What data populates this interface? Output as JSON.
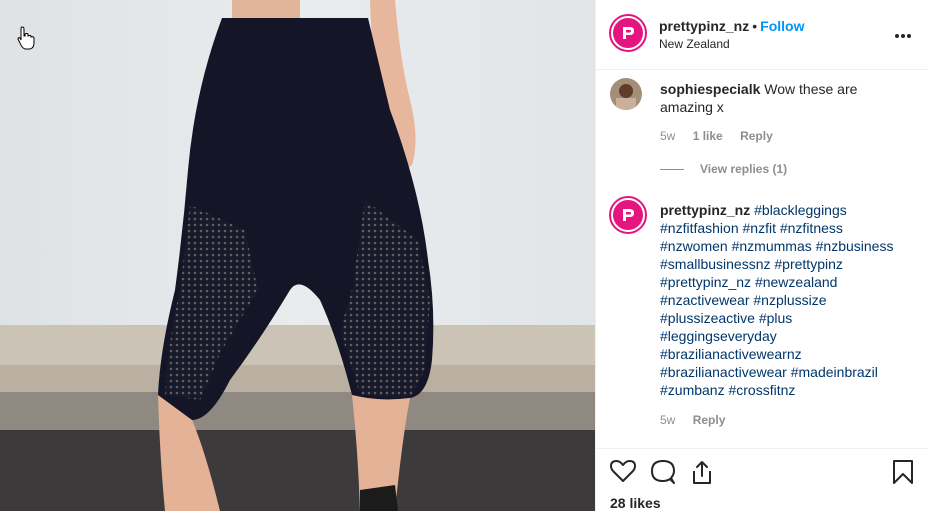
{
  "post": {
    "username": "prettypinz_nz",
    "separator": "•",
    "follow_label": "Follow",
    "location": "New Zealand",
    "more_icon": "more-options-icon"
  },
  "comment": {
    "username": "sophiespecialk",
    "text": "Wow these are amazing x",
    "age": "5w",
    "likes": "1 like",
    "reply_label": "Reply",
    "view_replies": "View replies (1)"
  },
  "caption": {
    "username": "prettypinz_nz",
    "hashtags": [
      "#blackleggings",
      "#nzfitfashion",
      "#nzfit",
      "#nzfitness",
      "#nzwomen",
      "#nzmummas",
      "#nzbusiness",
      "#smallbusinessnz",
      "#prettypinz",
      "#prettypinz_nz",
      "#newzealand",
      "#nzactivewear",
      "#nzplussize",
      "#plussizeactive",
      "#plus",
      "#leggingseveryday",
      "#brazilianactivewearnz",
      "#brazilianactivewear",
      "#madeinbrazil",
      "#zumbanz",
      "#crossfitnz"
    ],
    "age": "5w",
    "reply_label": "Reply"
  },
  "footer": {
    "likes": "28 likes"
  },
  "colors": {
    "brand": "#e4157f",
    "link": "#0095f6",
    "hashtag": "#00376b",
    "muted": "#8e8e8e",
    "text": "#262626"
  }
}
